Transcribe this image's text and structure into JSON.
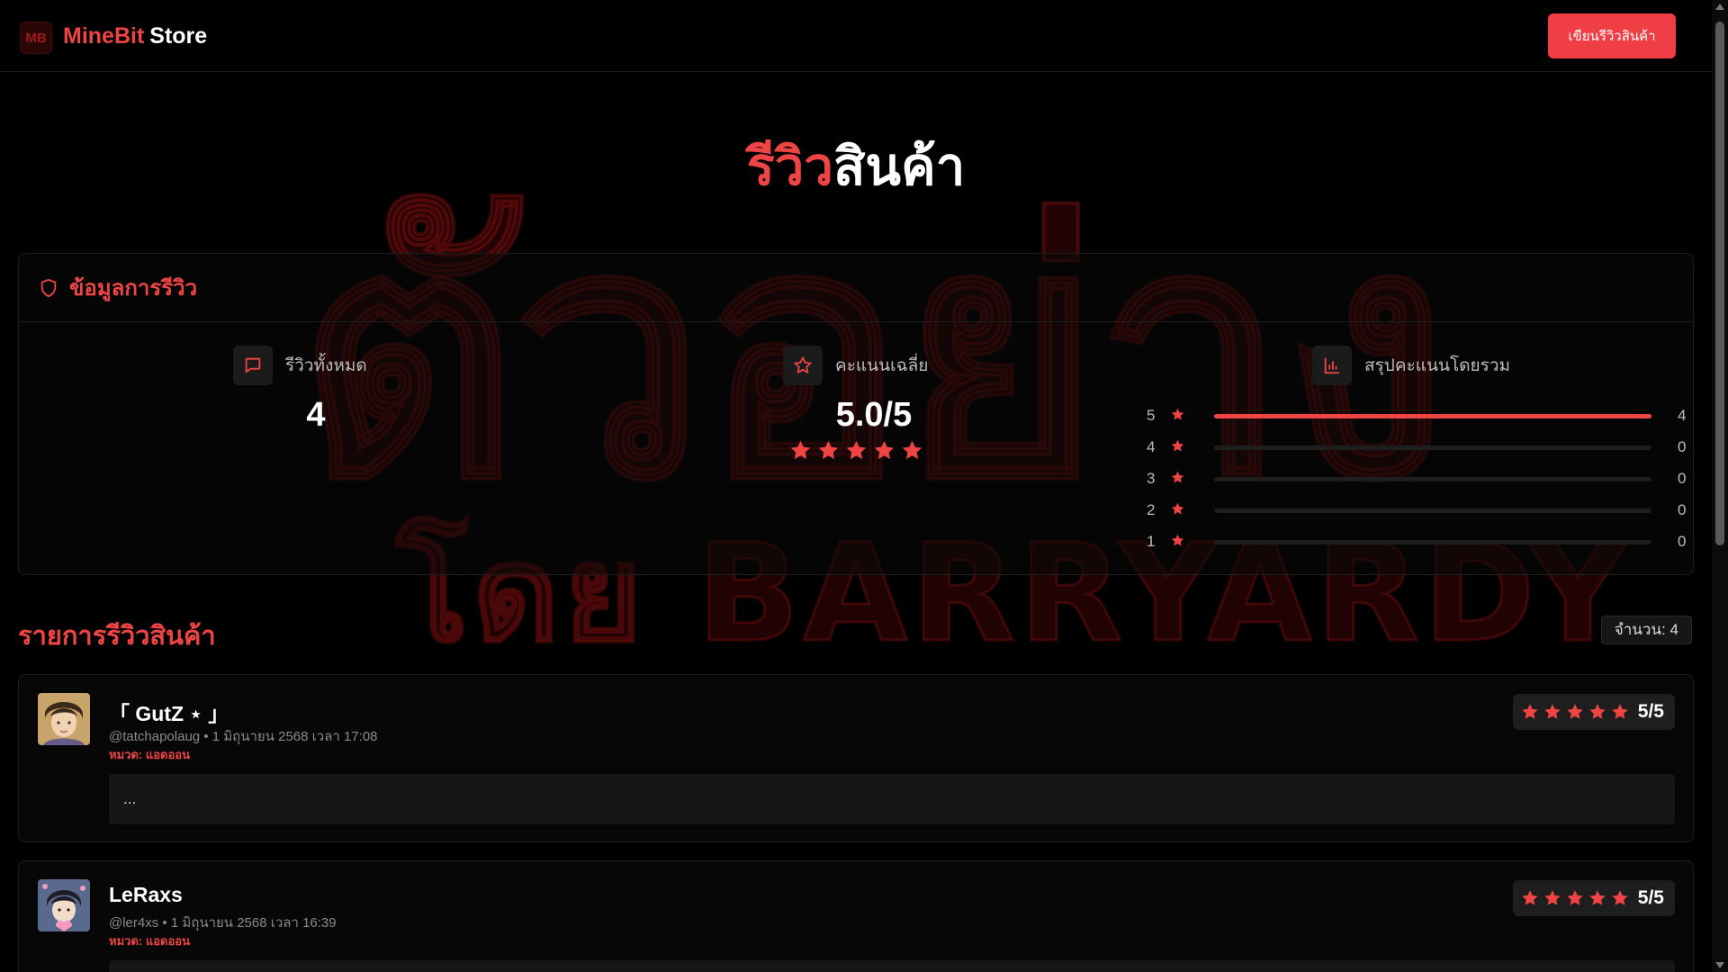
{
  "header": {
    "logo_text": "MB",
    "brand_first": "MineBit",
    "brand_second": "Store",
    "write_review_label": "เขียนรีวิวสินค้า"
  },
  "watermark": {
    "line1": "ตัวอย่าง",
    "line2": "โดย BARRYARDY"
  },
  "title": {
    "red_part": "รีวิว",
    "white_part": "สินค้า"
  },
  "info": {
    "heading": "ข้อมูลการรีวิว",
    "total_label": "รีวิวทั้งหมด",
    "total_value": "4",
    "avg_label": "คะแนนเฉลี่ย",
    "avg_value": "5.0/5",
    "avg_stars": 5,
    "summary_label": "สรุปคะแนนโดยรวม",
    "distribution": [
      {
        "stars": "5",
        "count": "4",
        "fraction": 1.0
      },
      {
        "stars": "4",
        "count": "0",
        "fraction": 0
      },
      {
        "stars": "3",
        "count": "0",
        "fraction": 0
      },
      {
        "stars": "2",
        "count": "0",
        "fraction": 0
      },
      {
        "stars": "1",
        "count": "0",
        "fraction": 0
      }
    ]
  },
  "list": {
    "title": "รายการรีวิวสินค้า",
    "count_label": "จำนวน: 4"
  },
  "reviews": [
    {
      "name": "「 GutZ ⋆ 」",
      "handle": "@tatchapolaug",
      "date": "1 มิถุนายน 2568 เวลา 17:08",
      "category": "หมวด: แอดออน",
      "rating": 5,
      "score": "5/5",
      "text": "..."
    },
    {
      "name": "LeRaxs",
      "handle": "@ler4xs",
      "date": "1 มิถุนายน 2568 เวลา 16:39",
      "category": "หมวด: แอดออน",
      "rating": 5,
      "score": "5/5",
      "text": ""
    }
  ],
  "colors": {
    "accent": "#ef4444",
    "background": "#000000",
    "card": "#0a0a0a",
    "muted": "#8a8a8a"
  }
}
